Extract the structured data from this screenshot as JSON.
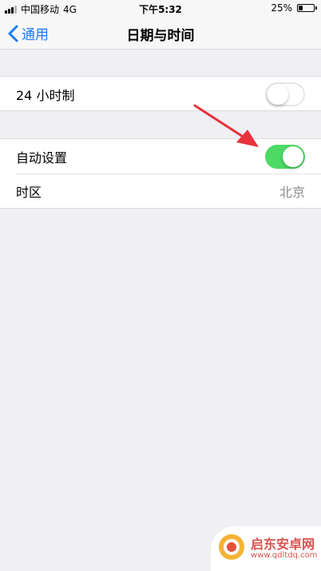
{
  "status_bar": {
    "carrier": "中国移动",
    "network": "4G",
    "time": "下午5:32",
    "battery": "25%",
    "battery_level": 0.25
  },
  "nav": {
    "back_label": "通用",
    "title": "日期与时间"
  },
  "settings": {
    "hour24": {
      "label": "24 小时制",
      "enabled": false
    },
    "auto_set": {
      "label": "自动设置",
      "enabled": true
    },
    "timezone": {
      "label": "时区",
      "value": "北京"
    }
  },
  "colors": {
    "accent": "#1a7cf5",
    "toggle_on": "#4cd964",
    "annotation_arrow": "#e8323c"
  },
  "watermark": {
    "title": "启东安卓网",
    "url": "www.qdltdq.com"
  }
}
